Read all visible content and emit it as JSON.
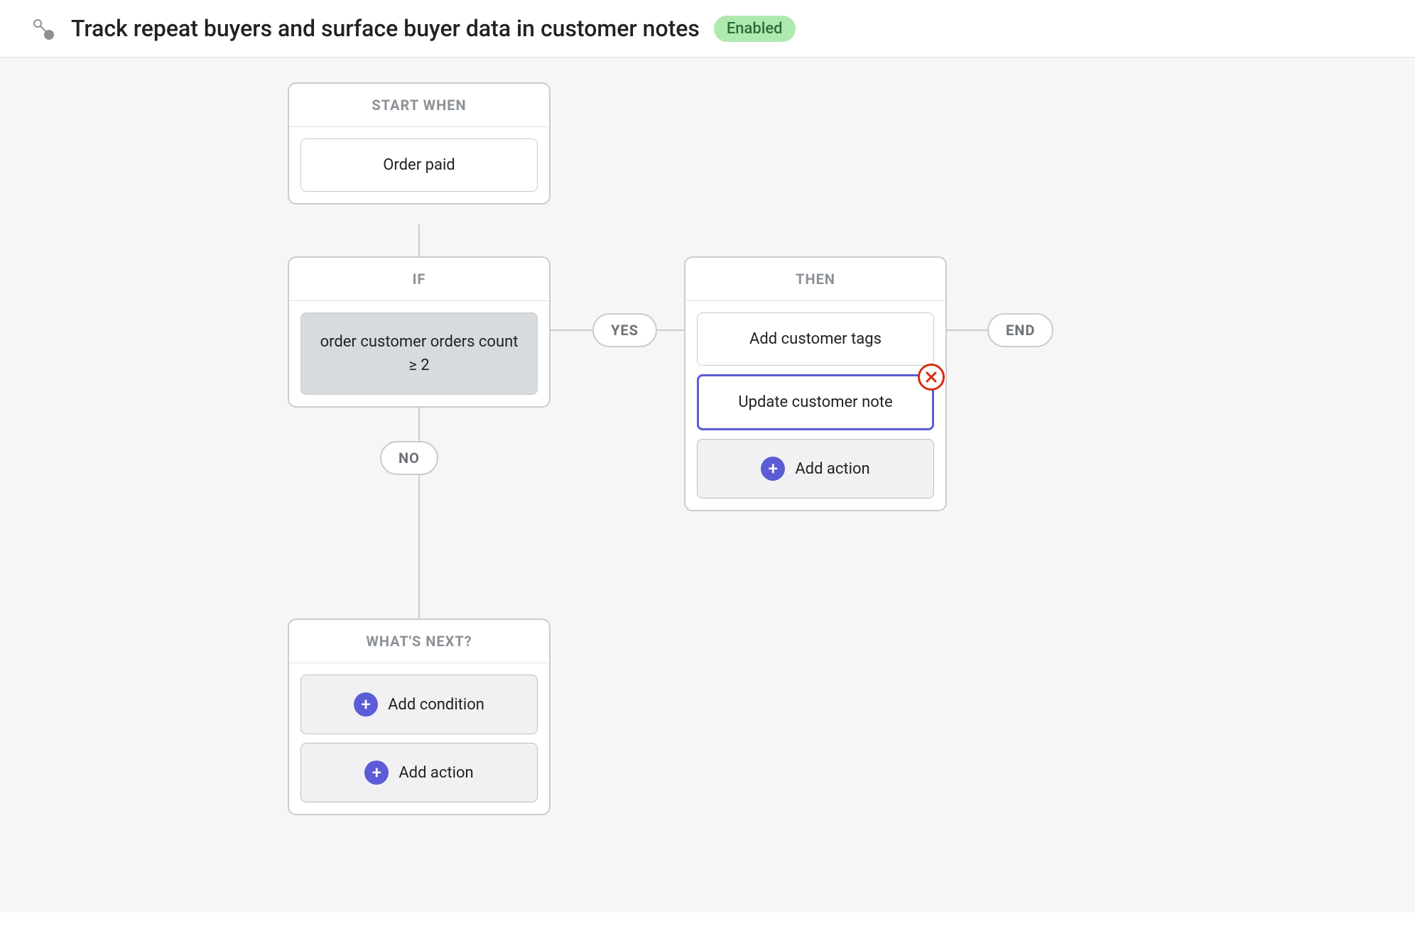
{
  "header": {
    "title": "Track repeat buyers and surface buyer data in customer notes",
    "status": "Enabled"
  },
  "start": {
    "header": "START WHEN",
    "trigger": "Order paid"
  },
  "condition": {
    "header": "IF",
    "text": "order customer orders count ≥ 2",
    "yes_label": "YES",
    "no_label": "NO"
  },
  "then": {
    "header": "THEN",
    "actions": [
      "Add customer tags",
      "Update customer note"
    ],
    "add_action_label": "Add action",
    "end_label": "END"
  },
  "whats_next": {
    "header": "WHAT'S NEXT?",
    "add_condition_label": "Add condition",
    "add_action_label": "Add action"
  }
}
